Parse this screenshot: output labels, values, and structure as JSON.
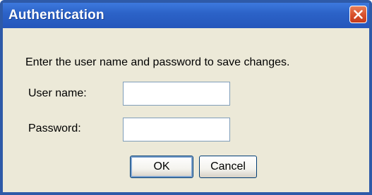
{
  "window": {
    "title": "Authentication"
  },
  "dialog": {
    "message": "Enter the user name and password to save changes.",
    "username_label": "User name:",
    "username_value": "",
    "password_label": "Password:",
    "password_value": "",
    "ok_label": "OK",
    "cancel_label": "Cancel"
  },
  "icons": {
    "close": "close-icon"
  },
  "colors": {
    "titlebar": "#2C63C8",
    "close_button": "#D9532E",
    "dialog_background": "#ECE9D8",
    "field_border": "#7F9DB9",
    "button_border": "#003C74"
  }
}
